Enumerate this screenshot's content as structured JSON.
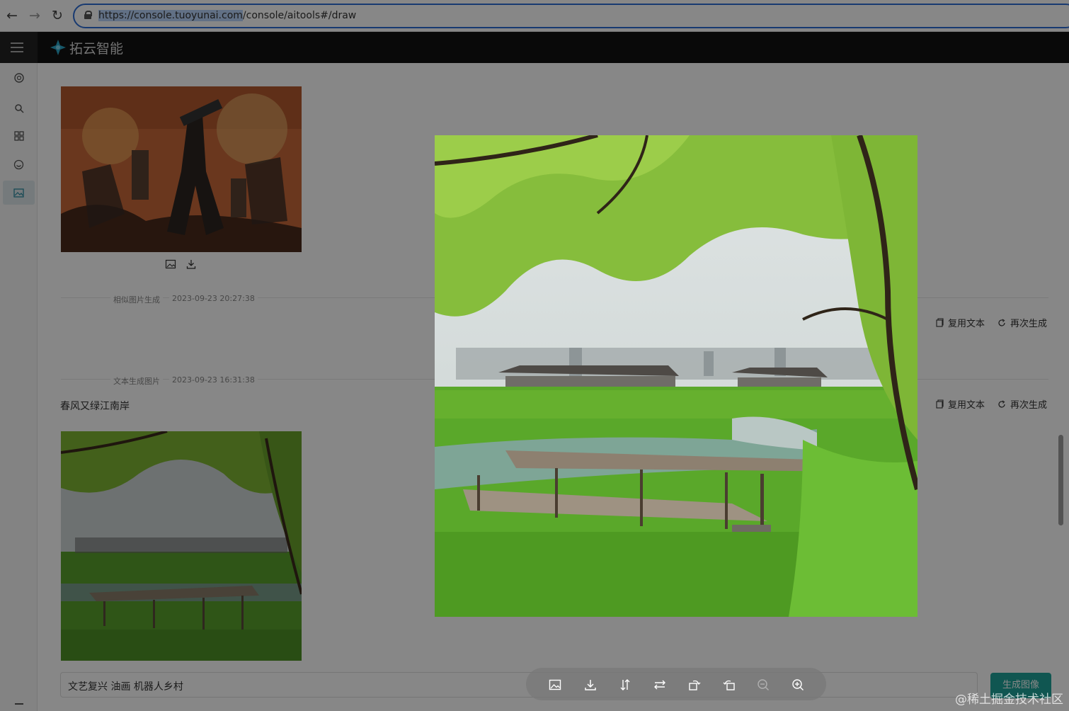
{
  "browser": {
    "url_host": "https://console.tuoyunai.com",
    "url_path": "/console/aitools#/draw"
  },
  "app": {
    "brand_name": "拓云智能"
  },
  "history": [
    {
      "type_label": "相似图片生成",
      "timestamp": "2023-09-23 20:27:38",
      "copy_text_label": "复用文本",
      "regenerate_label": "再次生成"
    },
    {
      "type_label": "文本生成图片",
      "timestamp": "2023-09-23 16:31:38",
      "prompt": "春风又绿江南岸",
      "copy_text_label": "复用文本",
      "regenerate_label": "再次生成"
    }
  ],
  "composer": {
    "prompt_value": "文艺复兴 油画 机器人乡村",
    "generate_label": "生成图像"
  },
  "preview_toolbar": {
    "icons": [
      "image-icon",
      "download-icon",
      "flip-vertical-icon",
      "flip-horizontal-icon",
      "rotate-left-icon",
      "rotate-right-icon",
      "zoom-out-icon",
      "zoom-in-icon"
    ]
  },
  "watermark": "@稀土掘金技术社区"
}
